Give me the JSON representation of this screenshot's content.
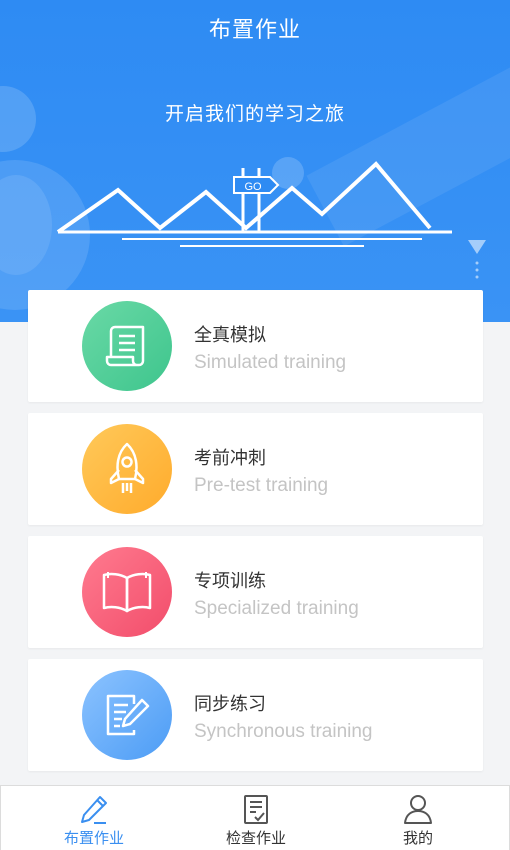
{
  "header": {
    "title": "布置作业",
    "slogan": "开启我们的学习之旅",
    "signpost_text": "GO"
  },
  "colors": {
    "hero_blue": "#2e8bf3",
    "green": "#3ec58d",
    "orange": "#ffab2c",
    "red": "#f24d6b",
    "blue": "#4c9cf5",
    "active_tab": "#3a8ff0"
  },
  "cards": [
    {
      "icon": "scroll-document-icon",
      "title": "全真模拟",
      "subtitle": "Simulated training"
    },
    {
      "icon": "rocket-icon",
      "title": "考前冲刺",
      "subtitle": "Pre-test training"
    },
    {
      "icon": "open-book-icon",
      "title": "专项训练",
      "subtitle": "Specialized training"
    },
    {
      "icon": "document-pen-icon",
      "title": "同步练习",
      "subtitle": "Synchronous training"
    }
  ],
  "tabbar": [
    {
      "icon": "pencil-icon",
      "label": "布置作业",
      "active": true
    },
    {
      "icon": "checklist-icon",
      "label": "检查作业",
      "active": false
    },
    {
      "icon": "user-icon",
      "label": "我的",
      "active": false
    }
  ]
}
